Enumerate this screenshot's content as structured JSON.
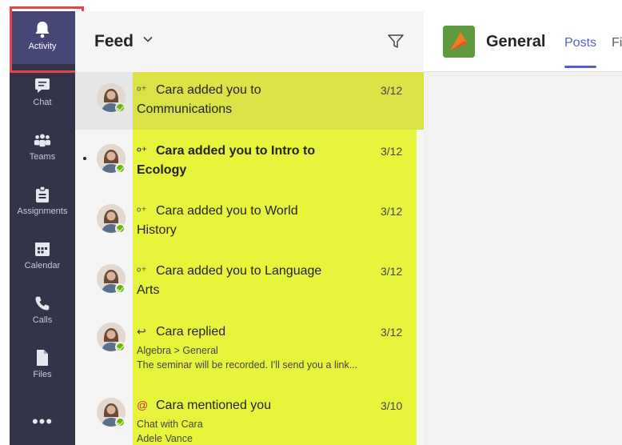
{
  "rail": {
    "items": [
      {
        "label": "Activity",
        "icon": "bell-icon",
        "active": true
      },
      {
        "label": "Chat",
        "icon": "chat-icon"
      },
      {
        "label": "Teams",
        "icon": "teams-icon"
      },
      {
        "label": "Assignments",
        "icon": "assignments-icon"
      },
      {
        "label": "Calendar",
        "icon": "calendar-icon"
      },
      {
        "label": "Calls",
        "icon": "phone-icon"
      },
      {
        "label": "Files",
        "icon": "files-icon"
      }
    ],
    "more": "•••"
  },
  "feed": {
    "title": "Feed",
    "items": [
      {
        "line1": "Cara added you to",
        "line2": "Communications",
        "date": "3/12",
        "icon": "team-add-icon",
        "unread": false
      },
      {
        "line1": "Cara added you to Intro to",
        "line2": "Ecology",
        "date": "3/12",
        "icon": "team-add-icon",
        "unread": true
      },
      {
        "line1": "Cara added you to World",
        "line2": "History",
        "date": "3/12",
        "icon": "team-add-icon",
        "unread": false
      },
      {
        "line1": "Cara added you to Language",
        "line2": "Arts",
        "date": "3/12",
        "icon": "team-add-icon",
        "unread": false
      },
      {
        "line1": "Cara replied",
        "sub1": "Algebra > General",
        "sub2": "The seminar will be recorded. I'll send you a link...",
        "date": "3/12",
        "icon": "reply-icon",
        "unread": false
      },
      {
        "line1": "Cara mentioned you",
        "sub1": "Chat with Cara",
        "sub2": "Adele Vance",
        "date": "3/10",
        "icon": "mention-icon",
        "unread": false
      }
    ]
  },
  "channel": {
    "title": "General",
    "tabs": [
      "Posts",
      "Fi"
    ]
  },
  "colors": {
    "rail": "#33344a",
    "highlight": "#e8f43c",
    "accent": "#5b5fc7",
    "callout": "#e2454c"
  }
}
